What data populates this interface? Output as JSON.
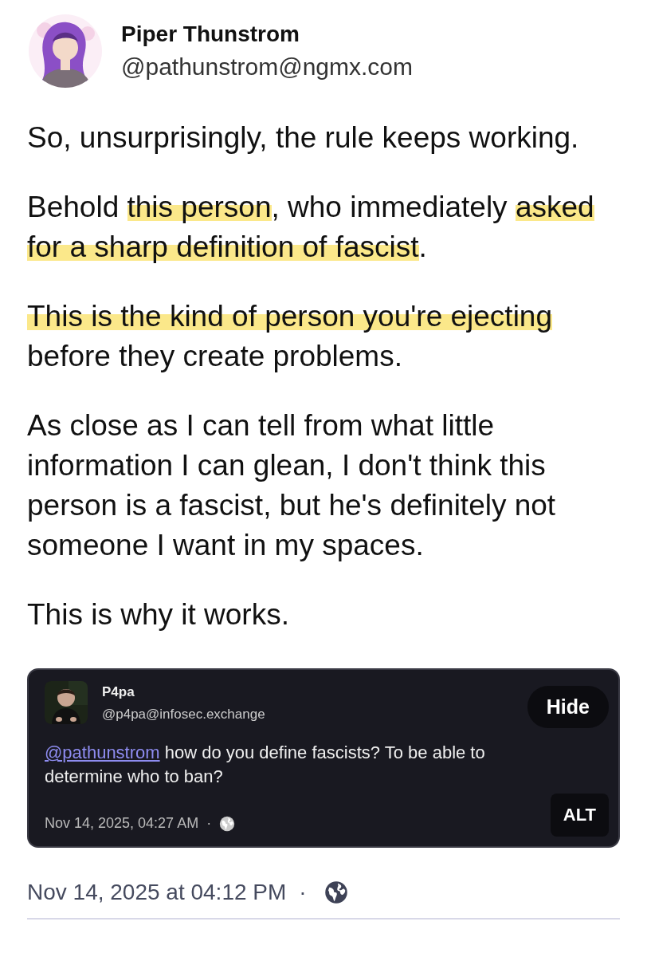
{
  "author": {
    "name": "Piper Thunstrom",
    "handle": "@pathunstrom@ngmx.com"
  },
  "paragraphs": [
    {
      "segments": [
        {
          "text": "So, unsurprisingly, the rule keeps working.",
          "highlighted": false
        }
      ]
    },
    {
      "segments": [
        {
          "text": "Behold ",
          "highlighted": false
        },
        {
          "text": "this person",
          "highlighted": true
        },
        {
          "text": ", who immediately ",
          "highlighted": false
        },
        {
          "text": "asked for a sharp definition of fascist",
          "highlighted": true
        },
        {
          "text": ".",
          "highlighted": false
        }
      ]
    },
    {
      "segments": [
        {
          "text": "This is the kind of person you're ejecting",
          "highlighted": true
        },
        {
          "text": " before they create problems.",
          "highlighted": false
        }
      ]
    },
    {
      "segments": [
        {
          "text": "As close as I can tell from what little information I can glean, I don't think this person is a fascist, but he's definitely not someone I want in my spaces.",
          "highlighted": false
        }
      ]
    },
    {
      "segments": [
        {
          "text": "This is why it works.",
          "highlighted": false
        }
      ]
    }
  ],
  "embedded_post": {
    "author": {
      "name": "P4pa",
      "handle": "@p4pa@infosec.exchange"
    },
    "hide_button": "Hide",
    "mention": "@pathunstrom",
    "text": " how do you define fascists? To be able to determine who to ban?",
    "timestamp": "Nov 14, 2025, 04:27 AM",
    "separator": "·",
    "alt_badge": "ALT"
  },
  "footer": {
    "timestamp": "Nov 14, 2025 at 04:12 PM",
    "separator": "·"
  }
}
